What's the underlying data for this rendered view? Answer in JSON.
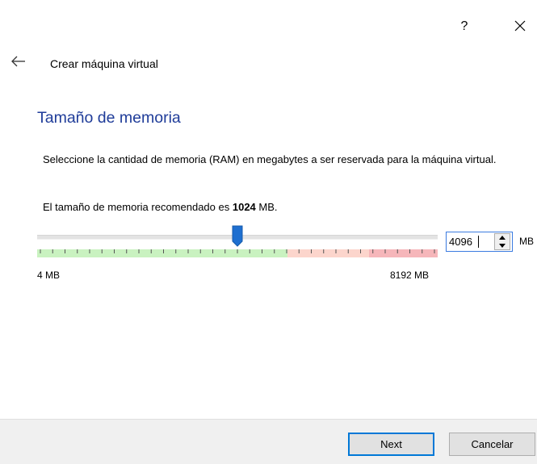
{
  "titlebar": {
    "help_label": "?",
    "close_icon": "close-icon"
  },
  "header": {
    "back_icon": "arrow-left-icon",
    "title": "Crear máquina virtual"
  },
  "page": {
    "title": "Tamaño de memoria",
    "description": "Seleccione la cantidad de memoria (RAM) en megabytes a ser reservada para la máquina virtual.",
    "recommended_prefix": "El tamaño de memoria recomendado es ",
    "recommended_value": "1024",
    "recommended_suffix": " MB."
  },
  "memory_slider": {
    "min_label": "4 MB",
    "max_label": "8192 MB",
    "min_mb": 4,
    "max_mb": 8192,
    "value_mb": 4096,
    "zones": {
      "ok_color": "#c9f2c0",
      "warn_color": "#fcd5cc",
      "bad_color": "#f6b6ba"
    },
    "thumb_color": "#1e6fd0"
  },
  "memory_spinbox": {
    "value": "4096",
    "unit": "MB"
  },
  "footer": {
    "next_label": "Next",
    "cancel_label": "Cancelar"
  },
  "colors": {
    "page_title": "#1f3c99",
    "focus_border": "#0078d7"
  }
}
